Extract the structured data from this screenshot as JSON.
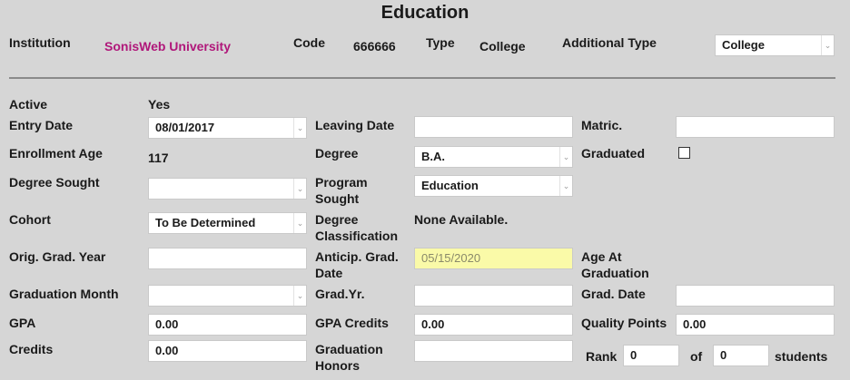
{
  "header": {
    "title": "Education",
    "institution_label": "Institution",
    "institution_value": "SonisWeb University",
    "code_label": "Code",
    "code_value": "666666",
    "type_label": "Type",
    "type_value": "College",
    "additional_type_label": "Additional Type",
    "additional_type_value": "College"
  },
  "fields": {
    "active_label": "Active",
    "active_value": "Yes",
    "entry_date_label": "Entry Date",
    "entry_date_value": "08/01/2017",
    "leaving_date_label": "Leaving Date",
    "leaving_date_value": "",
    "matric_label": "Matric.",
    "matric_value": "",
    "enrollment_age_label": "Enrollment Age",
    "enrollment_age_value": "117",
    "degree_label": "Degree",
    "degree_value": "B.A.",
    "graduated_label": "Graduated",
    "degree_sought_label": "Degree Sought",
    "degree_sought_value": "",
    "program_sought_label_1": "Program",
    "program_sought_label_2": "Sought",
    "program_sought_value": "Education",
    "cohort_label": "Cohort",
    "cohort_value": "To Be Determined",
    "degree_class_label_1": "Degree",
    "degree_class_label_2": "Classification",
    "degree_class_value": "None Available.",
    "orig_grad_year_label": "Orig. Grad. Year",
    "orig_grad_year_value": "",
    "anticip_grad_label_1": "Anticip. Grad.",
    "anticip_grad_label_2": "Date",
    "anticip_grad_value": "05/15/2020",
    "age_at_grad_label_1": "Age At",
    "age_at_grad_label_2": "Graduation",
    "grad_month_label": "Graduation Month",
    "grad_month_value": "",
    "grad_yr_label": "Grad.Yr.",
    "grad_yr_value": "",
    "grad_date_label": "Grad. Date",
    "grad_date_value": "",
    "gpa_label": "GPA",
    "gpa_value": "0.00",
    "gpa_credits_label": "GPA Credits",
    "gpa_credits_value": "0.00",
    "quality_points_label": "Quality Points",
    "quality_points_value": "0.00",
    "credits_label": "Credits",
    "credits_value": "0.00",
    "grad_honors_label_1": "Graduation",
    "grad_honors_label_2": "Honors",
    "grad_honors_value": "",
    "rank_label": "Rank",
    "rank_value": "0",
    "of_label": "of",
    "of_value": "0",
    "students_label": "students"
  },
  "icons": {
    "dropdown": "chevron-down-icon"
  }
}
